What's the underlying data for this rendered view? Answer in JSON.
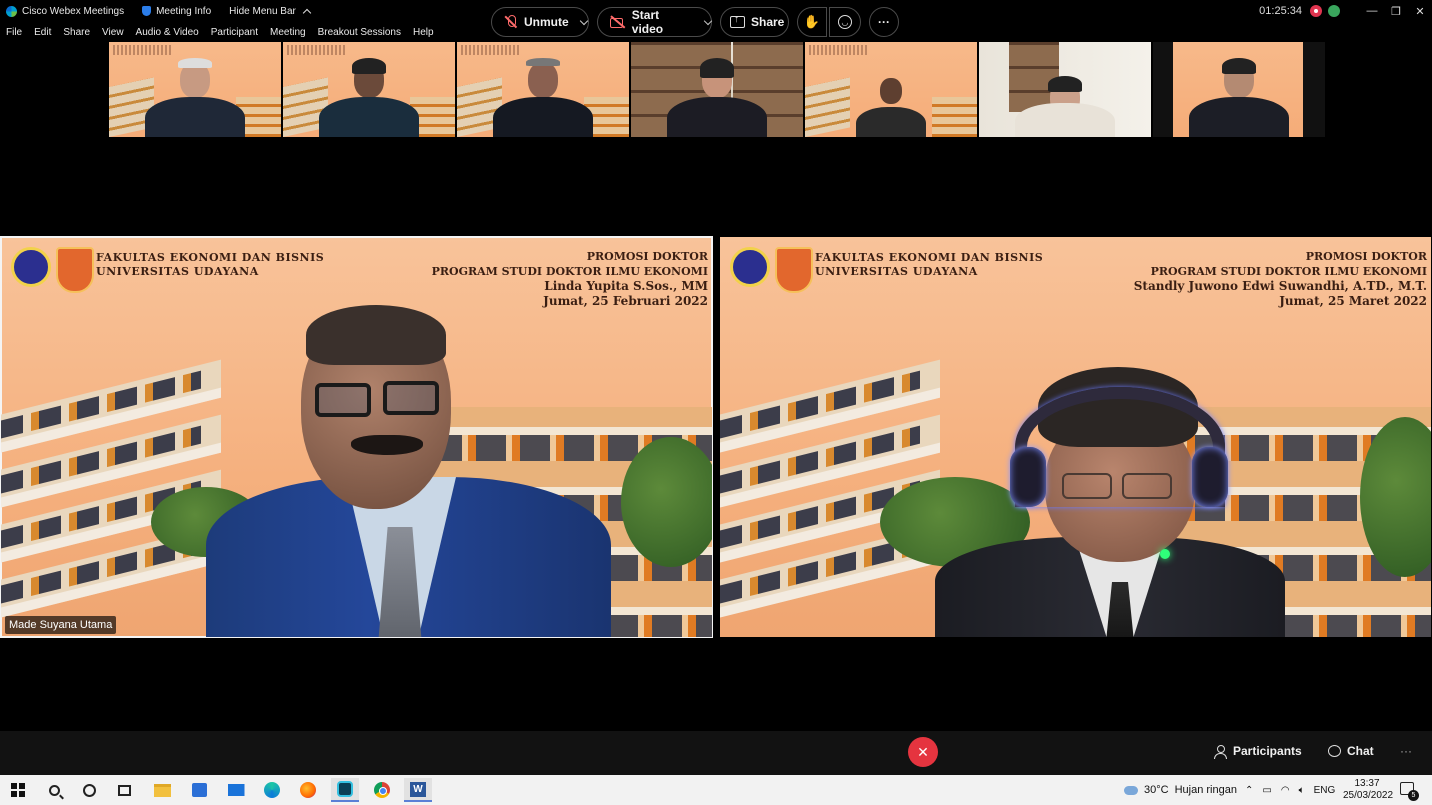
{
  "titlebar": {
    "app_name": "Cisco Webex Meetings",
    "meeting_info": "Meeting Info",
    "hide_menu": "Hide Menu Bar",
    "time": "01:25:34",
    "minimize": "—",
    "restore": "❐",
    "close": "✕"
  },
  "menu": {
    "items": [
      "File",
      "Edit",
      "Share",
      "View",
      "Audio & Video",
      "Participant",
      "Meeting",
      "Breakout Sessions",
      "Help"
    ]
  },
  "tiles": {
    "left": {
      "faculty_line1": "FAKULTAS EKONOMI DAN BISNIS",
      "faculty_line2": "UNIVERSITAS UDAYANA",
      "promo_line1": "PROMOSI DOKTOR",
      "promo_line2": "PROGRAM STUDI DOKTOR ILMU EKONOMI",
      "promo_line3": "Linda Yupita S.Sos., MM",
      "promo_line4": "Jumat, 25 Februari 2022",
      "participant_name": "Made Suyana Utama"
    },
    "right": {
      "faculty_line1": "FAKULTAS EKONOMI DAN BISNIS",
      "faculty_line2": "UNIVERSITAS UDAYANA",
      "promo_line1": "PROMOSI DOKTOR",
      "promo_line2": "PROGRAM STUDI DOKTOR ILMU EKONOMI",
      "promo_line3": "Standly Juwono Edwi Suwandhi, A.TD., M.T.",
      "promo_line4": "Jumat, 25 Maret 2022"
    }
  },
  "controls": {
    "unmute": "Unmute",
    "start_video": "Start video",
    "share": "Share",
    "more": "···",
    "leave": "✕",
    "participants": "Participants",
    "chat": "Chat",
    "overflow": "···"
  },
  "taskbar": {
    "temperature": "30°C",
    "weather": "Hujan ringan",
    "language": "ENG",
    "time": "13:37",
    "date": "25/03/2022",
    "notifications": "5"
  },
  "colors": {
    "leave_red": "#e5343f",
    "muted_red": "#ff6b6b",
    "tile_orange": "#f5b07e"
  }
}
